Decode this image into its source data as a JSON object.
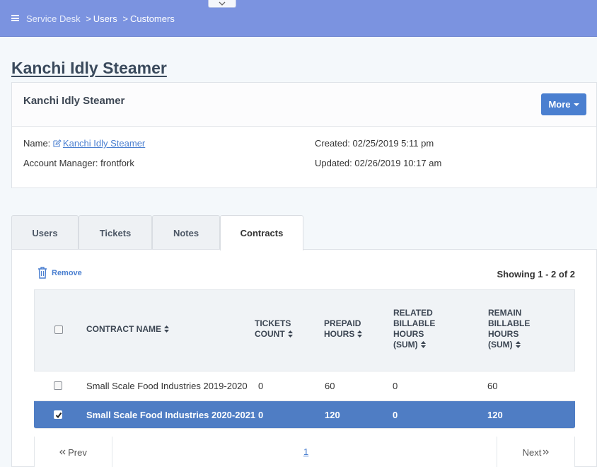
{
  "breadcrumb": {
    "home": "Service Desk",
    "level1": "Users",
    "level2": "Customers",
    "separator": ">"
  },
  "page": {
    "title": "Kanchi Idly Steamer"
  },
  "card": {
    "title": "Kanchi Idly Steamer",
    "more_label": "More",
    "name_label": "Name:",
    "name_value": "Kanchi Idly Steamer",
    "manager_label": "Account Manager:",
    "manager_value": "frontfork",
    "created_label": "Created:",
    "created_value": "02/25/2019 5:11 pm",
    "updated_label": "Updated:",
    "updated_value": "02/26/2019 10:17 am"
  },
  "tabs": [
    {
      "label": "Users"
    },
    {
      "label": "Tickets"
    },
    {
      "label": "Notes"
    },
    {
      "label": "Contracts"
    }
  ],
  "contracts": {
    "remove_label": "Remove",
    "showing": "Showing 1 - 2 of 2",
    "columns": {
      "name": "CONTRACT NAME",
      "tickets_l1": "TICKETS",
      "tickets_l2": "COUNT",
      "prepaid_l1": "PREPAID",
      "prepaid_l2": "HOURS",
      "related_l1": "RELATED",
      "related_l2": "BILLABLE",
      "related_l3": "HOURS",
      "related_l4": "(SUM)",
      "remain_l1": "REMAIN",
      "remain_l2": "BILLABLE",
      "remain_l3": "HOURS",
      "remain_l4": "(SUM)"
    },
    "rows": [
      {
        "name": "Small Scale Food Industries 2019-2020",
        "tickets": "0",
        "prepaid": "60",
        "related": "0",
        "remain": "60",
        "selected": false
      },
      {
        "name": "Small Scale Food Industries 2020-2021",
        "tickets": "0",
        "prepaid": "120",
        "related": "0",
        "remain": "120",
        "selected": true
      }
    ],
    "pager": {
      "prev": "Prev",
      "next": "Next",
      "page": "1"
    }
  },
  "colors": {
    "topbar": "#7b93e0",
    "accent": "#4a7fd0",
    "selected_row": "#4f7dc4"
  },
  "icons": [
    "hamburger-icon",
    "chevron-down-icon",
    "edit-icon",
    "trash-icon",
    "sort-icon",
    "check-icon",
    "double-chevron-left-icon",
    "double-chevron-right-icon"
  ]
}
